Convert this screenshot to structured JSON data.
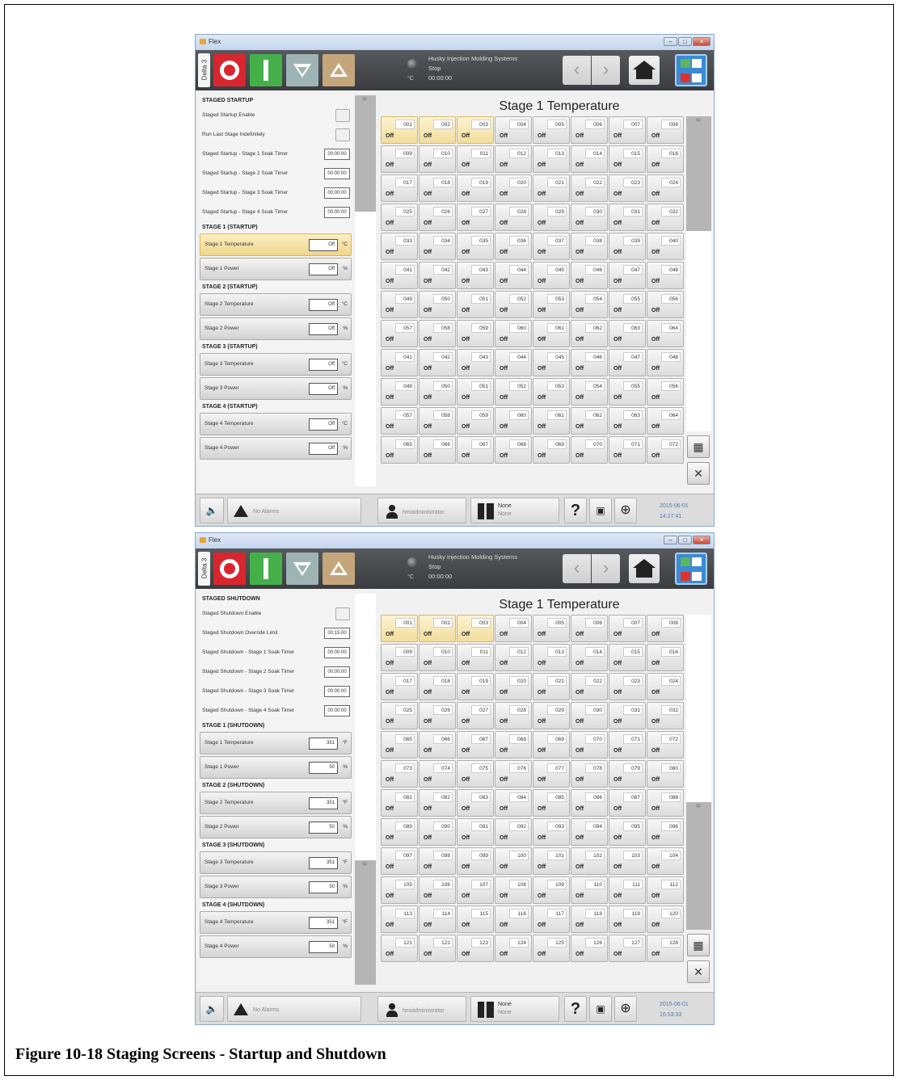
{
  "figure": {
    "caption": "Figure 10-18  Staging Screens - Startup and Shutdown"
  },
  "common": {
    "window_title": "Flex",
    "side_tab": "Delta 3",
    "status": {
      "company": "Husky Injection Molding Systems",
      "state": "Stop",
      "unit": "°C",
      "time": "00:00:00"
    },
    "bottom": {
      "alarms": "No Alarms",
      "user": "hmiadministrator",
      "mold_name": "None",
      "mold_sub": "None"
    }
  },
  "screens": [
    {
      "section_title": "STAGED STARTUP",
      "settings": [
        {
          "label": "Staged Startup Enable",
          "type": "checkbox"
        },
        {
          "label": "Run Last Stage Indefinitely",
          "type": "checkbox"
        },
        {
          "label": "Staged Startup - Stage 1 Soak Timer",
          "type": "time",
          "value": "00:00:00"
        },
        {
          "label": "Staged Startup - Stage 2 Soak Timer",
          "type": "time",
          "value": "00:00:00"
        },
        {
          "label": "Staged Startup - Stage 3 Soak Timer",
          "type": "time",
          "value": "00:00:00"
        },
        {
          "label": "Staged Startup - Stage 4 Soak Timer",
          "type": "time",
          "value": "00:00:00"
        }
      ],
      "stages": [
        {
          "header": "STAGE 1 (STARTUP)",
          "temp_label": "Stage 1 Temperature",
          "temp_value": "Off",
          "temp_unit": "°C",
          "power_label": "Stage 1 Power",
          "power_value": "Off",
          "power_unit": "%",
          "highlight": true
        },
        {
          "header": "STAGE 2 (STARTUP)",
          "temp_label": "Stage 2 Temperature",
          "temp_value": "Off",
          "temp_unit": "°C",
          "power_label": "Stage 2 Power",
          "power_value": "Off",
          "power_unit": "%"
        },
        {
          "header": "STAGE 3 (STARTUP)",
          "temp_label": "Stage 3 Temperature",
          "temp_value": "Off",
          "temp_unit": "°C",
          "power_label": "Stage 3 Power",
          "power_value": "Off",
          "power_unit": "%"
        },
        {
          "header": "STAGE 4 (STARTUP)",
          "temp_label": "Stage 4 Temperature",
          "temp_value": "Off",
          "temp_unit": "°C",
          "power_label": "Stage 4 Power",
          "power_value": "Off",
          "power_unit": "%"
        }
      ],
      "grid_title": "Stage 1 Temperature",
      "zone_value": "Off",
      "selected_zones": [
        "001",
        "002",
        "003"
      ],
      "zones": [
        "001",
        "002",
        "003",
        "004",
        "005",
        "006",
        "007",
        "008",
        "009",
        "010",
        "011",
        "012",
        "013",
        "014",
        "015",
        "016",
        "017",
        "018",
        "019",
        "020",
        "021",
        "022",
        "023",
        "024",
        "025",
        "026",
        "027",
        "028",
        "029",
        "030",
        "031",
        "032",
        "033",
        "034",
        "035",
        "036",
        "037",
        "038",
        "039",
        "040",
        "041",
        "042",
        "043",
        "044",
        "045",
        "046",
        "047",
        "048",
        "049",
        "050",
        "051",
        "052",
        "053",
        "054",
        "055",
        "056",
        "057",
        "058",
        "059",
        "060",
        "061",
        "062",
        "063",
        "064",
        "041",
        "042",
        "043",
        "044",
        "045",
        "046",
        "047",
        "048",
        "049",
        "050",
        "051",
        "052",
        "053",
        "054",
        "055",
        "056",
        "057",
        "058",
        "059",
        "060",
        "061",
        "062",
        "063",
        "064",
        "065",
        "066",
        "067",
        "068",
        "069",
        "070",
        "071",
        "072"
      ],
      "date": "2015-06-01",
      "clock": "14:27:41"
    },
    {
      "section_title": "STAGED SHUTDOWN",
      "settings": [
        {
          "label": "Staged Shutdown Enable",
          "type": "checkbox"
        },
        {
          "label": "Staged Shutdown Override Limit",
          "type": "time",
          "value": "00:15:00"
        },
        {
          "label": "Staged Shutdown - Stage 1 Soak Timer",
          "type": "time",
          "value": "00:00:00"
        },
        {
          "label": "Staged Shutdown - Stage 2 Soak Timer",
          "type": "time",
          "value": "00:00:00"
        },
        {
          "label": "Staged Shutdown - Stage 3 Soak Timer",
          "type": "time",
          "value": "00:00:00"
        },
        {
          "label": "Staged Shutdown - Stage 4 Soak Timer",
          "type": "time",
          "value": "00:00:00"
        }
      ],
      "stages": [
        {
          "header": "STAGE 1 (SHUTDOWN)",
          "temp_label": "Stage 1 Temperature",
          "temp_value": "351",
          "temp_unit": "°F",
          "power_label": "Stage 1 Power",
          "power_value": "50",
          "power_unit": "%"
        },
        {
          "header": "STAGE 2 (SHUTDOWN)",
          "temp_label": "Stage 2 Temperature",
          "temp_value": "351",
          "temp_unit": "°F",
          "power_label": "Stage 2 Power",
          "power_value": "50",
          "power_unit": "%"
        },
        {
          "header": "STAGE 3 (SHUTDOWN)",
          "temp_label": "Stage 3 Temperature",
          "temp_value": "351",
          "temp_unit": "°F",
          "power_label": "Stage 3 Power",
          "power_value": "50",
          "power_unit": "%"
        },
        {
          "header": "STAGE 4 (SHUTDOWN)",
          "temp_label": "Stage 4 Temperature",
          "temp_value": "351",
          "temp_unit": "°F",
          "power_label": "Stage 4 Power",
          "power_value": "50",
          "power_unit": "%"
        }
      ],
      "grid_title": "Stage 1 Temperature",
      "zone_value": "Off",
      "selected_zones": [
        "001",
        "002",
        "003"
      ],
      "zones": [
        "001",
        "002",
        "003",
        "004",
        "005",
        "006",
        "007",
        "008",
        "009",
        "010",
        "011",
        "012",
        "013",
        "014",
        "015",
        "016",
        "017",
        "018",
        "019",
        "020",
        "021",
        "022",
        "023",
        "024",
        "025",
        "026",
        "027",
        "028",
        "029",
        "030",
        "031",
        "032",
        "065",
        "066",
        "067",
        "068",
        "069",
        "070",
        "071",
        "072",
        "073",
        "074",
        "075",
        "076",
        "077",
        "078",
        "079",
        "080",
        "081",
        "082",
        "083",
        "084",
        "085",
        "086",
        "087",
        "088",
        "089",
        "090",
        "091",
        "092",
        "093",
        "094",
        "095",
        "096",
        "097",
        "098",
        "099",
        "100",
        "101",
        "102",
        "103",
        "104",
        "105",
        "106",
        "107",
        "108",
        "109",
        "110",
        "111",
        "112",
        "113",
        "114",
        "115",
        "116",
        "117",
        "118",
        "119",
        "120",
        "121",
        "122",
        "123",
        "124",
        "125",
        "126",
        "127",
        "128"
      ],
      "date": "2015-06-01",
      "clock": "16:53:33"
    }
  ]
}
